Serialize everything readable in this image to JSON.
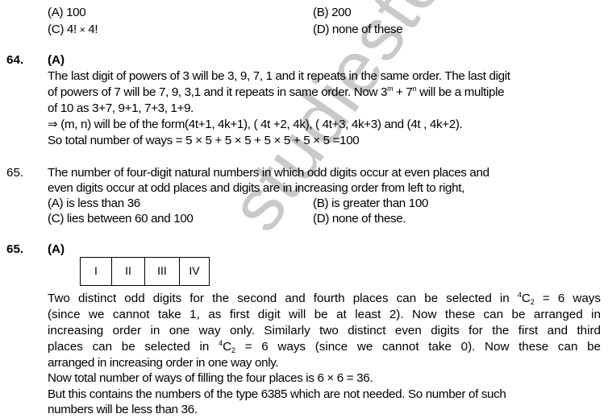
{
  "watermark": "studiestoday.com",
  "prev_options": {
    "a": "(A)  100",
    "b": "(B)  200",
    "c_prefix": "(C)  4! ",
    "c_times": "×",
    "c_suffix": " 4!",
    "d": "(D) none of these"
  },
  "answer64": {
    "number": "64.",
    "answer": "(A)",
    "line1": "The last digit of powers of 3 will be 3, 9, 7, 1 and it repeats in the  same order. The last digit",
    "line2_pre": "of powers of 7 will be 7, 9, 3,1 and it repeats in same order. Now  3",
    "line2_sup1": "m",
    "line2_mid": " + 7",
    "line2_sup2": "n",
    "line2_post": " will be a  multiple",
    "line3": "of  10 as  3+7,  9+1,  7+3, 1+9.",
    "line4": "⇒ (m, n) will be  of the  form(4t+1, 4k+1), ( 4t +2, 4k), ( 4t+3, 4k+3) and (4t , 4k+2).",
    "line5": "So total number of  ways =  5 × 5 + 5 × 5 + 5 × 5 + 5 × 5 =100"
  },
  "question65": {
    "number": "65.",
    "line1": "The number of four-digit natural numbers in which odd  digits  occur  at even places and",
    "line2": "even digits occur at odd places and  digits  are in increasing  order from  left  to right,",
    "options": {
      "a": "(A) is less than  36",
      "b": "(B) is greater than 100",
      "c": "(C) lies between  60 and  100",
      "d": "(D) none of these."
    }
  },
  "answer65": {
    "number": "65.",
    "answer": "(A)",
    "places": [
      "I",
      "II",
      "III",
      "IV"
    ],
    "line1_pre": "Two distinct odd digits for the second and fourth places can be selected in ",
    "line1_sup": "4",
    "line1_c": "C",
    "line1_sub": "2",
    "line1_post": " = 6 ways",
    "line2": "(since we cannot take  1, as first digit  will be at least 2). Now these can be arranged in",
    "line3": "increasing order in one way only. Similarly two distinct even digits for the first and third",
    "line4_pre": "places can be selected in ",
    "line4_sup": "4",
    "line4_c": "C",
    "line4_sub": "2",
    "line4_post": " = 6 ways (since we cannot take 0). Now these can be",
    "line5": "arranged in increasing order in one  way only.",
    "line6": "Now total number of ways of filling the four places is  6 × 6 = 36.",
    "line7": "But this contains the numbers of the type 6385 which are not needed. So number of   such",
    "line8": "numbers will be less than 36."
  }
}
